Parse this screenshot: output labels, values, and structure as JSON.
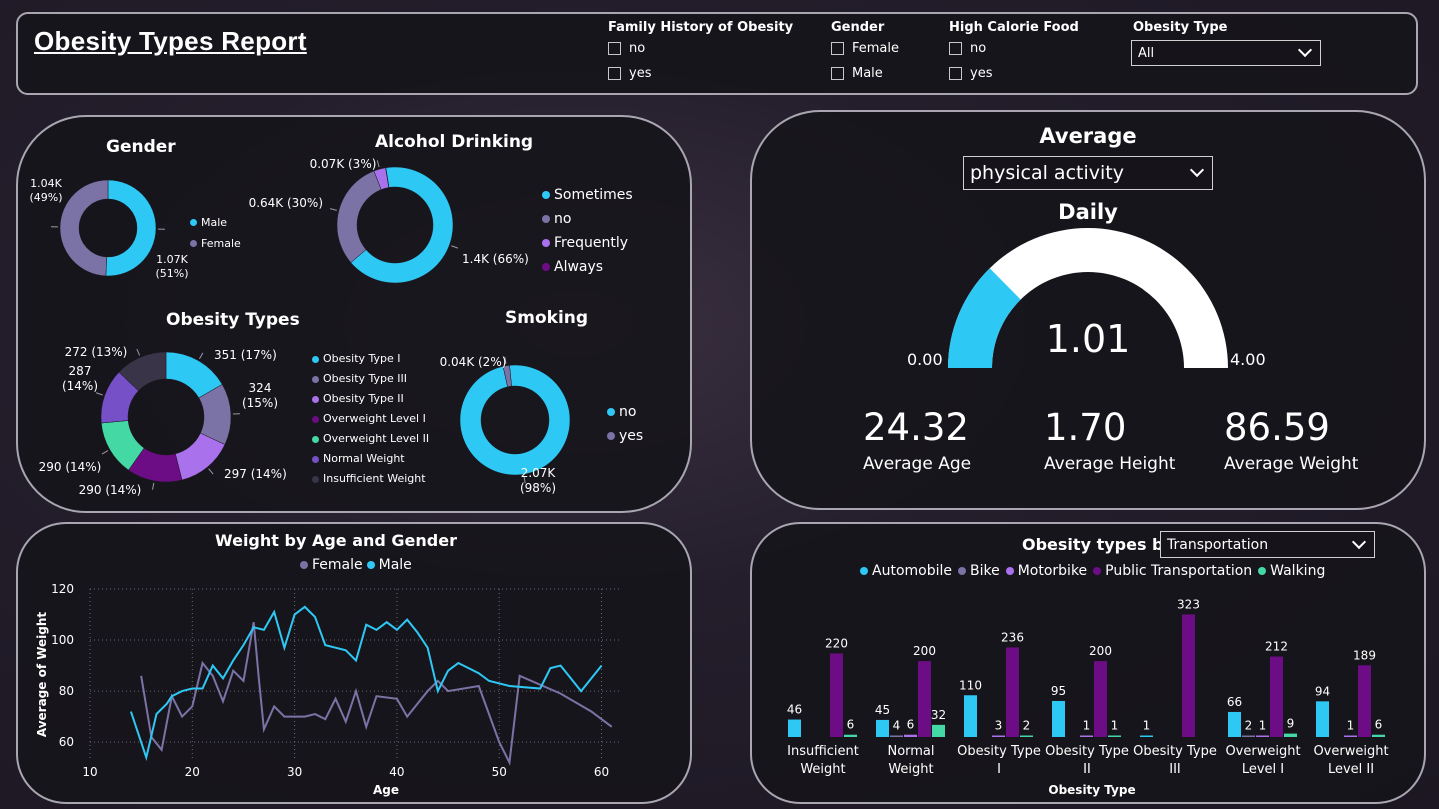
{
  "header": {
    "title": "Obesity Types Report",
    "filters": [
      {
        "title": "Family History of Obesity",
        "options": [
          "no",
          "yes"
        ]
      },
      {
        "title": "Gender",
        "options": [
          "Female",
          "Male"
        ]
      },
      {
        "title": "High Calorie Food",
        "options": [
          "no",
          "yes"
        ]
      }
    ],
    "obesity_type": {
      "title": "Obesity Type",
      "value": "All"
    }
  },
  "colors": {
    "cyan": "#2ec8f5",
    "slate": "#7b72a6",
    "lavender": "#a972ec",
    "purple": "#6c0d86",
    "green": "#44d8a4",
    "violet": "#7650c6",
    "dark": "#3a3448",
    "white": "#ffffff"
  },
  "average_panel": {
    "title": "Average",
    "dropdown_value": "physical activity",
    "gauge_title": "Daily",
    "gauge_value_label": "1.01",
    "gauge_min_label": "0.00",
    "gauge_max_label": "4.00",
    "kpis": [
      {
        "value": "24.32",
        "label": "Average Age"
      },
      {
        "value": "1.70",
        "label": "Average Height"
      },
      {
        "value": "86.59",
        "label": "Average Weight"
      }
    ]
  },
  "types_panel": {
    "title_prefix": "Obesity types by",
    "dropdown_value": "Transportation"
  },
  "chart_data": [
    {
      "id": "gender",
      "type": "pie",
      "title": "Gender",
      "slices": [
        {
          "name": "Male",
          "value": 1.07,
          "label": "1.07K\n(51%)",
          "color": "#2ec8f5"
        },
        {
          "name": "Female",
          "value": 1.04,
          "label": "1.04K\n(49%)",
          "color": "#7b72a6"
        }
      ],
      "legend": [
        "Male",
        "Female"
      ]
    },
    {
      "id": "alcohol",
      "type": "pie",
      "title": "Alcohol Drinking",
      "slices": [
        {
          "name": "Sometimes",
          "value": 1.4,
          "label": "1.4K (66%)",
          "color": "#2ec8f5"
        },
        {
          "name": "no",
          "value": 0.64,
          "label": "0.64K (30%)",
          "color": "#7b72a6"
        },
        {
          "name": "Frequently",
          "value": 0.07,
          "label": "0.07K (3%)",
          "color": "#a972ec"
        },
        {
          "name": "Always",
          "value": 0.001,
          "label": "",
          "color": "#6c0d86"
        }
      ],
      "legend": [
        "Sometimes",
        "no",
        "Frequently",
        "Always"
      ]
    },
    {
      "id": "obesity_types",
      "type": "pie",
      "title": "Obesity Types",
      "slices": [
        {
          "name": "Obesity Type I",
          "value": 351,
          "label": "351 (17%)",
          "color": "#2ec8f5"
        },
        {
          "name": "Obesity Type III",
          "value": 324,
          "label": "324\n(15%)",
          "color": "#7b72a6"
        },
        {
          "name": "Obesity Type II",
          "value": 297,
          "label": "297 (14%)",
          "color": "#a972ec"
        },
        {
          "name": "Overweight Level I",
          "value": 290,
          "label": "290 (14%)",
          "color": "#6c0d86"
        },
        {
          "name": "Overweight Level II",
          "value": 290,
          "label": "290 (14%)",
          "color": "#44d8a4"
        },
        {
          "name": "Normal Weight",
          "value": 287,
          "label": "287\n(14%)",
          "color": "#7650c6"
        },
        {
          "name": "Insufficient Weight",
          "value": 272,
          "label": "272 (13%)",
          "color": "#3a3448"
        }
      ],
      "legend": [
        "Obesity Type I",
        "Obesity Type III",
        "Obesity Type II",
        "Overweight Level I",
        "Overweight Level II",
        "Normal Weight",
        "Insufficient Weight"
      ]
    },
    {
      "id": "smoking",
      "type": "pie",
      "title": "Smoking",
      "slices": [
        {
          "name": "no",
          "value": 2.07,
          "label": "2.07K\n(98%)",
          "color": "#2ec8f5"
        },
        {
          "name": "yes",
          "value": 0.04,
          "label": "0.04K (2%)",
          "color": "#7b72a6"
        }
      ],
      "legend": [
        "no",
        "yes"
      ]
    },
    {
      "id": "weight_age",
      "type": "line",
      "title": "Weight by Age and Gender",
      "xlabel": "Age",
      "ylabel": "Average of Weight",
      "xlim": [
        10,
        62
      ],
      "ylim": [
        53,
        120
      ],
      "xticks": [
        10,
        20,
        30,
        40,
        50,
        60
      ],
      "yticks": [
        60,
        80,
        100,
        120
      ],
      "grid": true,
      "legend_position": "top",
      "series": [
        {
          "name": "Female",
          "color": "#7b72a6",
          "points": [
            [
              15,
              86
            ],
            [
              16,
              62
            ],
            [
              17,
              57
            ],
            [
              18,
              78
            ],
            [
              19,
              70
            ],
            [
              20,
              74
            ],
            [
              21,
              91
            ],
            [
              22,
              86
            ],
            [
              23,
              76
            ],
            [
              24,
              88
            ],
            [
              25,
              84
            ],
            [
              26,
              107
            ],
            [
              26.5,
              85
            ],
            [
              27,
              65
            ],
            [
              28,
              74
            ],
            [
              29,
              70
            ],
            [
              30,
              70
            ],
            [
              31,
              70
            ],
            [
              32,
              71
            ],
            [
              33,
              69
            ],
            [
              34,
              77
            ],
            [
              35,
              68
            ],
            [
              36,
              80
            ],
            [
              37,
              66
            ],
            [
              38,
              78
            ],
            [
              40,
              77
            ],
            [
              41,
              70
            ],
            [
              43,
              80
            ],
            [
              44,
              84
            ],
            [
              45,
              80
            ],
            [
              48,
              82
            ],
            [
              50,
              60
            ],
            [
              51,
              52
            ],
            [
              52,
              86
            ],
            [
              56,
              79
            ],
            [
              59,
              72
            ],
            [
              61,
              66
            ]
          ]
        },
        {
          "name": "Male",
          "color": "#2ec8f5",
          "points": [
            [
              14,
              72
            ],
            [
              15.5,
              54
            ],
            [
              16.5,
              71
            ],
            [
              17.5,
              75
            ],
            [
              18,
              78
            ],
            [
              19,
              80
            ],
            [
              20,
              81
            ],
            [
              21,
              81
            ],
            [
              22,
              90
            ],
            [
              23,
              85
            ],
            [
              24,
              92
            ],
            [
              25,
              98
            ],
            [
              26,
              105
            ],
            [
              27,
              104
            ],
            [
              28,
              111
            ],
            [
              29,
              97
            ],
            [
              30,
              110
            ],
            [
              31,
              113
            ],
            [
              32,
              109
            ],
            [
              33,
              98
            ],
            [
              34,
              97
            ],
            [
              35,
              96
            ],
            [
              36,
              92
            ],
            [
              37,
              106
            ],
            [
              38,
              104
            ],
            [
              39,
              107
            ],
            [
              40,
              104
            ],
            [
              41,
              108
            ],
            [
              42,
              103
            ],
            [
              43,
              97
            ],
            [
              44,
              80
            ],
            [
              45,
              88
            ],
            [
              46,
              91
            ],
            [
              47,
              89
            ],
            [
              48,
              87
            ],
            [
              49,
              84
            ],
            [
              51,
              82
            ],
            [
              54,
              81
            ],
            [
              55,
              89
            ],
            [
              56,
              90
            ],
            [
              57,
              85
            ],
            [
              58,
              80
            ],
            [
              60,
              90
            ]
          ]
        }
      ]
    },
    {
      "id": "obesity_transport",
      "type": "bar",
      "xlabel": "Obesity Type",
      "categories": [
        "Insufficient\nWeight",
        "Normal\nWeight",
        "Obesity Type\nI",
        "Obesity Type\nII",
        "Obesity Type\nIII",
        "Overweight\nLevel I",
        "Overweight\nLevel II"
      ],
      "ylim": [
        0,
        340
      ],
      "series": [
        {
          "name": "Automobile",
          "color": "#2ec8f5",
          "values": [
            46,
            45,
            110,
            95,
            1,
            66,
            94
          ]
        },
        {
          "name": "Bike",
          "color": "#7b72a6",
          "values": [
            0,
            4,
            0,
            0,
            0,
            2,
            0
          ]
        },
        {
          "name": "Motorbike",
          "color": "#a972ec",
          "values": [
            0,
            6,
            3,
            1,
            0,
            1,
            1
          ]
        },
        {
          "name": "Public Transportation",
          "color": "#6c0d86",
          "values": [
            220,
            200,
            236,
            200,
            323,
            212,
            189
          ]
        },
        {
          "name": "Walking",
          "color": "#44d8a4",
          "values": [
            6,
            32,
            2,
            1,
            0,
            9,
            6
          ]
        }
      ]
    }
  ]
}
